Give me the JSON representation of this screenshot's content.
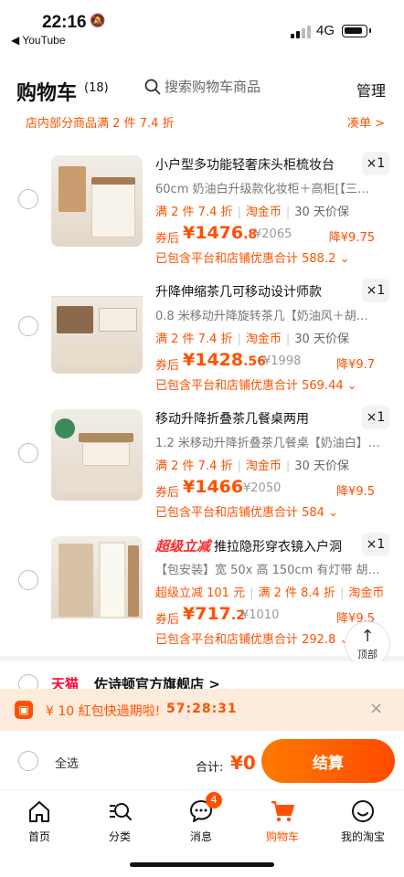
{
  "status": {
    "time": "22:16",
    "back_app": "◀ YouTube",
    "network": "4G"
  },
  "header": {
    "title": "购物车",
    "count": "(18)",
    "search_placeholder": "搜索购物车商品",
    "manage": "管理",
    "promo": "店内部分商品满 2 件 7.4 折",
    "promo_link": "凑单 >"
  },
  "items": [
    {
      "name": "小户型多功能轻奢床头柜梳妆台",
      "qty": "×1",
      "sku": "60cm 奶油白升级款化妆柜＋高柜[【三…",
      "tag1": "满 2 件 7.4 折",
      "tag2": "淘金币",
      "tag3": "30 天价保",
      "after": "券后",
      "price_int": "¥1476",
      "price_dec": ".8",
      "original": "¥2065",
      "drop": "降¥9.75",
      "coupon": "已包含平台和店铺优惠合计 588.2 ⌄"
    },
    {
      "name": "升降伸缩茶几可移动设计师款",
      "qty": "×1",
      "sku": "0.8 米移动升降旋转茶几【奶油风＋胡…",
      "tag1": "满 2 件 7.4 折",
      "tag2": "淘金币",
      "tag3": "30 天价保",
      "after": "券后",
      "price_int": "¥1428",
      "price_dec": ".56",
      "original": "¥1998",
      "drop": "降¥9.7",
      "coupon": "已包含平台和店铺优惠合计 569.44 ⌄"
    },
    {
      "name": "移动升降折叠茶几餐桌两用",
      "qty": "×1",
      "sku": "1.2 米移动升降折叠茶几餐桌【奶油白】…",
      "tag1": "满 2 件 7.4 折",
      "tag2": "淘金币",
      "tag3": "30 天价保",
      "after": "券后",
      "price_int": "¥1466",
      "price_dec": "",
      "original": "¥2050",
      "drop": "降¥9.5",
      "coupon": "已包含平台和店铺优惠合计 584 ⌄"
    },
    {
      "super_logo": "超级立减",
      "name": "推拉隐形穿衣镜入户洞",
      "qty": "×1",
      "sku": "【包安装】宽 50x 高 150cm 有灯带 胡…",
      "tag1": "超级立减 101 元",
      "tag2": "满 2 件 8.4 折",
      "tag3": "淘金币",
      "after": "券后",
      "price_int": "¥717",
      "price_dec": ".2",
      "original": "¥1010",
      "drop": "降¥9.5",
      "coupon": "已包含平台和店铺优惠合计 292.8 ⌄"
    }
  ],
  "back_to_top": {
    "arrow": "↑",
    "label": "顶部"
  },
  "store": {
    "logo": "天猫",
    "name": "佐诗顿官方旗舰店 >"
  },
  "redpacket": {
    "text": "¥ 10 紅包快過期啦!",
    "timer": "57:28:31",
    "close": "×"
  },
  "checkout": {
    "select_all": "全选",
    "total_label": "合计:",
    "total_value": "¥0",
    "button": "结算"
  },
  "tabs": [
    {
      "label": "首页",
      "icon": "home-icon"
    },
    {
      "label": "分类",
      "icon": "category-search-icon"
    },
    {
      "label": "消息",
      "icon": "message-icon",
      "badge": "4"
    },
    {
      "label": "购物车",
      "icon": "cart-icon"
    },
    {
      "label": "我的淘宝",
      "icon": "smile-icon"
    }
  ],
  "colors": {
    "accent": "#ff5000",
    "tmall": "#ff0036"
  }
}
